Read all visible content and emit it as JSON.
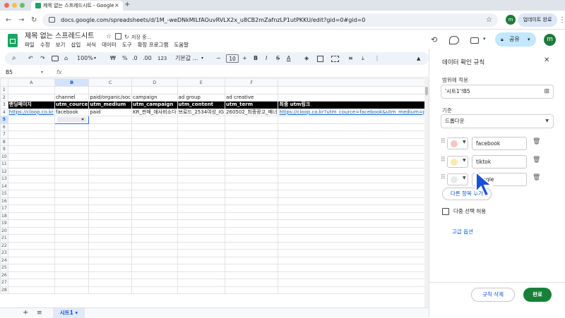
{
  "browser": {
    "tab_title": "제목 없는 스프레드시트 - Google",
    "url": "docs.google.com/spreadsheets/d/1M_-weDNkMlLfAOuvRVLX2x_u8CB2mZafnzLP1utPKKU/edit?gid=0#gid=0",
    "profile_initial": "m",
    "update_label": "업데이트 완료"
  },
  "sheets": {
    "doc_title": "제목 없는 스프레드시트",
    "saving_status": "저장 중...",
    "menu": [
      "파일",
      "수정",
      "보기",
      "삽입",
      "서식",
      "데이터",
      "도구",
      "확장 프로그램",
      "도움말"
    ],
    "share_label": "공유",
    "user_initial": "m"
  },
  "toolbar": {
    "zoom": "100%",
    "currency": "₩",
    "percent": "%",
    "decimal_dec": ".0",
    "decimal_inc": ".00",
    "number_format": "123",
    "font": "기본값 ...",
    "font_size": "10",
    "bold": "B",
    "italic": "I",
    "strike": "S",
    "text_color": "A"
  },
  "formula_bar": {
    "cell_ref": "B5"
  },
  "grid": {
    "columns": [
      "A",
      "B",
      "C",
      "D",
      "E",
      "F",
      ""
    ],
    "rows": [
      {
        "num": "1",
        "cells": [
          "",
          "",
          "",
          "",
          "",
          "",
          ""
        ]
      },
      {
        "num": "2",
        "cells": [
          "",
          "channel",
          "paid/organic/soc",
          "campaign",
          "ad group",
          "ad creative",
          ""
        ]
      },
      {
        "num": "3",
        "cells": [
          "랜딩페이지",
          "utm_cource",
          "utm_medium",
          "utm_campaign",
          "utm_content",
          "utm_term",
          "최종 utm링크"
        ]
      },
      {
        "num": "4",
        "cells": [
          "https://cloop.co.kr",
          "facebook",
          "paid",
          "KR_판매_애사비소다",
          "브로드_2534여성_IG",
          "260502_최종광고_배너",
          "https://cloop.co.kr?utm_cource=facebook&utm_medium=paid&utm_campaign=KR_판매_애사비소다&utm_content=브로드_2534여성_IG&utm_term=260502_최종광고_배너"
        ]
      },
      {
        "num": "5",
        "cells": [
          "",
          "",
          "",
          "",
          "",
          "",
          ""
        ]
      },
      {
        "num": "6",
        "cells": [
          "",
          "",
          "",
          "",
          "",
          "",
          ""
        ]
      },
      {
        "num": "7",
        "cells": [
          "",
          "",
          "",
          "",
          "",
          "",
          ""
        ]
      },
      {
        "num": "8",
        "cells": [
          "",
          "",
          "",
          "",
          "",
          "",
          ""
        ]
      },
      {
        "num": "9",
        "cells": [
          "",
          "",
          "",
          "",
          "",
          "",
          ""
        ]
      },
      {
        "num": "10",
        "cells": [
          "",
          "",
          "",
          "",
          "",
          "",
          ""
        ]
      },
      {
        "num": "11",
        "cells": [
          "",
          "",
          "",
          "",
          "",
          "",
          ""
        ]
      },
      {
        "num": "12",
        "cells": [
          "",
          "",
          "",
          "",
          "",
          "",
          ""
        ]
      },
      {
        "num": "13",
        "cells": [
          "",
          "",
          "",
          "",
          "",
          "",
          ""
        ]
      },
      {
        "num": "14",
        "cells": [
          "",
          "",
          "",
          "",
          "",
          "",
          ""
        ]
      },
      {
        "num": "15",
        "cells": [
          "",
          "",
          "",
          "",
          "",
          "",
          ""
        ]
      },
      {
        "num": "16",
        "cells": [
          "",
          "",
          "",
          "",
          "",
          "",
          ""
        ]
      },
      {
        "num": "17",
        "cells": [
          "",
          "",
          "",
          "",
          "",
          "",
          ""
        ]
      },
      {
        "num": "18",
        "cells": [
          "",
          "",
          "",
          "",
          "",
          "",
          ""
        ]
      },
      {
        "num": "19",
        "cells": [
          "",
          "",
          "",
          "",
          "",
          "",
          ""
        ]
      },
      {
        "num": "20",
        "cells": [
          "",
          "",
          "",
          "",
          "",
          "",
          ""
        ]
      },
      {
        "num": "21",
        "cells": [
          "",
          "",
          "",
          "",
          "",
          "",
          ""
        ]
      },
      {
        "num": "22",
        "cells": [
          "",
          "",
          "",
          "",
          "",
          "",
          ""
        ]
      },
      {
        "num": "23",
        "cells": [
          "",
          "",
          "",
          "",
          "",
          "",
          ""
        ]
      },
      {
        "num": "24",
        "cells": [
          "",
          "",
          "",
          "",
          "",
          "",
          ""
        ]
      },
      {
        "num": "25",
        "cells": [
          "",
          "",
          "",
          "",
          "",
          "",
          ""
        ]
      },
      {
        "num": "26",
        "cells": [
          "",
          "",
          "",
          "",
          "",
          "",
          ""
        ]
      },
      {
        "num": "27",
        "cells": [
          "",
          "",
          "",
          "",
          "",
          "",
          ""
        ]
      },
      {
        "num": "28",
        "cells": [
          "",
          "",
          "",
          "",
          "",
          "",
          ""
        ]
      }
    ]
  },
  "sheet_tabs": [
    {
      "label": "시트1"
    }
  ],
  "panel": {
    "title": "데이터 확인 규칙",
    "range_label": "범위에 적용",
    "range_value": "'시트1'!B5",
    "criteria_label": "기준",
    "criteria_value": "드롭다운",
    "options": [
      {
        "value": "facebook",
        "color": "#f4c7c3"
      },
      {
        "value": "tiktok",
        "color": "#fce8b2"
      },
      {
        "value": "google",
        "color": "#e8eaed"
      }
    ],
    "add_option": "다른 항목 추가",
    "multi_select": "다중 선택 허용",
    "advanced": "고급 옵션",
    "delete_rule": "규칙 삭제",
    "done": "완료"
  }
}
